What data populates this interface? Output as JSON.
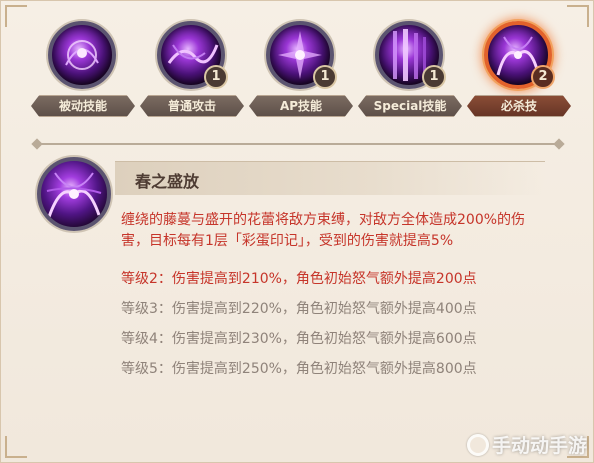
{
  "skill_tabs": [
    {
      "label": "被动技能",
      "level": ""
    },
    {
      "label": "普通攻击",
      "level": "1"
    },
    {
      "label": "AP技能",
      "level": "1"
    },
    {
      "label": "Special技能",
      "level": "1"
    },
    {
      "label": "必杀技",
      "level": "2"
    }
  ],
  "selected_tab_index": 4,
  "skill_detail": {
    "name": "春之盛放",
    "description_line1": "缠绕的藤蔓与盛开的花蕾将敌方束缚，对敌方全体造成200%的伤",
    "description_line2": "害，目标每有1层「彩蛋印记」，受到的伤害就提高5%",
    "levels": [
      {
        "text": "等级2：伤害提高到210%，角色初始怒气额外提高200点",
        "current": true
      },
      {
        "text": "等级3：伤害提高到220%，角色初始怒气额外提高400点",
        "current": false
      },
      {
        "text": "等级4：伤害提高到230%，角色初始怒气额外提高600点",
        "current": false
      },
      {
        "text": "等级5：伤害提高到250%，角色初始怒气额外提高800点",
        "current": false
      }
    ]
  },
  "watermark": "手动动手游",
  "colors": {
    "highlight_text": "#c6352a",
    "locked_text": "#8f837a",
    "active_border": "#e2622b",
    "background": "#f3ece1"
  }
}
